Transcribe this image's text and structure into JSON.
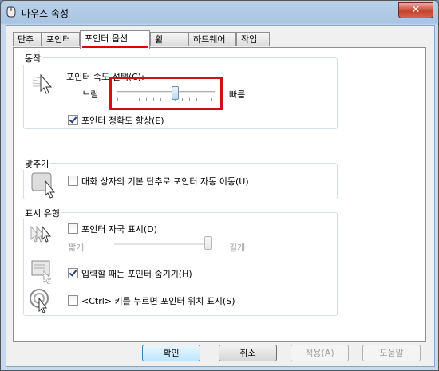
{
  "window": {
    "title": "마우스 속성",
    "close_symbol": "✕"
  },
  "tabs": [
    {
      "label": "단추",
      "active": false
    },
    {
      "label": "포인터",
      "active": false
    },
    {
      "label": "포인터 옵션",
      "active": true
    },
    {
      "label": "휠",
      "active": false
    },
    {
      "label": "하드웨어",
      "active": false
    },
    {
      "label": "작업",
      "active": false
    }
  ],
  "motion": {
    "group_label": "동작",
    "speed_label": "포인터 속도 선택(C):",
    "slow_label": "느림",
    "fast_label": "빠름",
    "speed_level": 0.6,
    "enhance_precision_label": "포인터 정확도 향상(E)",
    "enhance_precision_checked": true
  },
  "snap_to": {
    "group_label": "맞추기",
    "snap_label": "대화 상자의 기본 단추로 포인터 자동 이동(U)",
    "snap_checked": false
  },
  "visibility": {
    "group_label": "표시 유형",
    "trails_label": "포인터 자국 표시(D)",
    "trails_checked": false,
    "short_label": "짧게",
    "long_label": "길게",
    "trails_level": 1.0,
    "hide_label": "입력할 때는 포인터 숨기기(H)",
    "hide_checked": true,
    "ctrl_label": "<Ctrl> 키를 누르면 포인터 위치 표시(S)",
    "ctrl_checked": false
  },
  "buttons": {
    "ok": "확인",
    "cancel": "취소",
    "apply": "적용(A)",
    "help": "도움말"
  },
  "colors": {
    "highlight": "#d10f1b",
    "tab_underline": "#e00000"
  }
}
